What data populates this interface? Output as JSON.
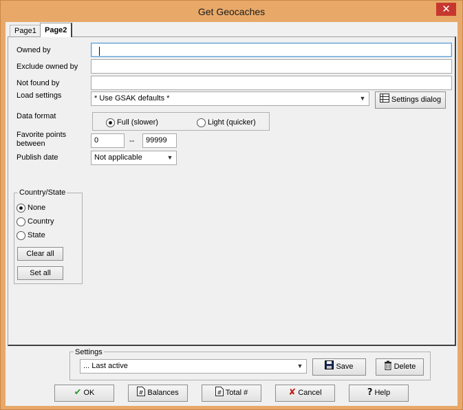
{
  "window": {
    "title": "Get Geocaches",
    "close_glyph": "✕",
    "accent_color": "#e8a868"
  },
  "tabs": [
    {
      "label": "Page1",
      "active": false
    },
    {
      "label": "Page2",
      "active": true
    }
  ],
  "form": {
    "owned_by": {
      "label": "Owned by",
      "value": ""
    },
    "exclude_owned_by": {
      "label": "Exclude owned by",
      "value": ""
    },
    "not_found_by": {
      "label": "Not found by",
      "value": ""
    },
    "load_settings": {
      "label": "Load settings",
      "value": "* Use GSAK defaults *"
    },
    "settings_dialog_button": {
      "label": "Settings dialog",
      "icon": "grid-icon"
    },
    "data_format": {
      "label": "Data format",
      "options": [
        {
          "label": "Full (slower)",
          "selected": true
        },
        {
          "label": "Light (quicker)",
          "selected": false
        }
      ]
    },
    "favorite_points": {
      "label_line1": "Favorite points",
      "label_line2": "between",
      "min": "0",
      "separator": "--",
      "max": "99999"
    },
    "publish_date": {
      "label": "Publish date",
      "value": "Not applicable"
    }
  },
  "country_state": {
    "title": "Country/State",
    "options": [
      {
        "label": "None",
        "selected": true
      },
      {
        "label": "Country",
        "selected": false
      },
      {
        "label": "State",
        "selected": false
      }
    ],
    "clear_all": "Clear all",
    "set_all": "Set all"
  },
  "settings": {
    "title": "Settings",
    "value": "... Last active",
    "save": "Save",
    "delete": "Delete"
  },
  "buttons": {
    "ok": "OK",
    "balances": "Balances",
    "total": "Total #",
    "cancel": "Cancel",
    "help": "Help"
  }
}
